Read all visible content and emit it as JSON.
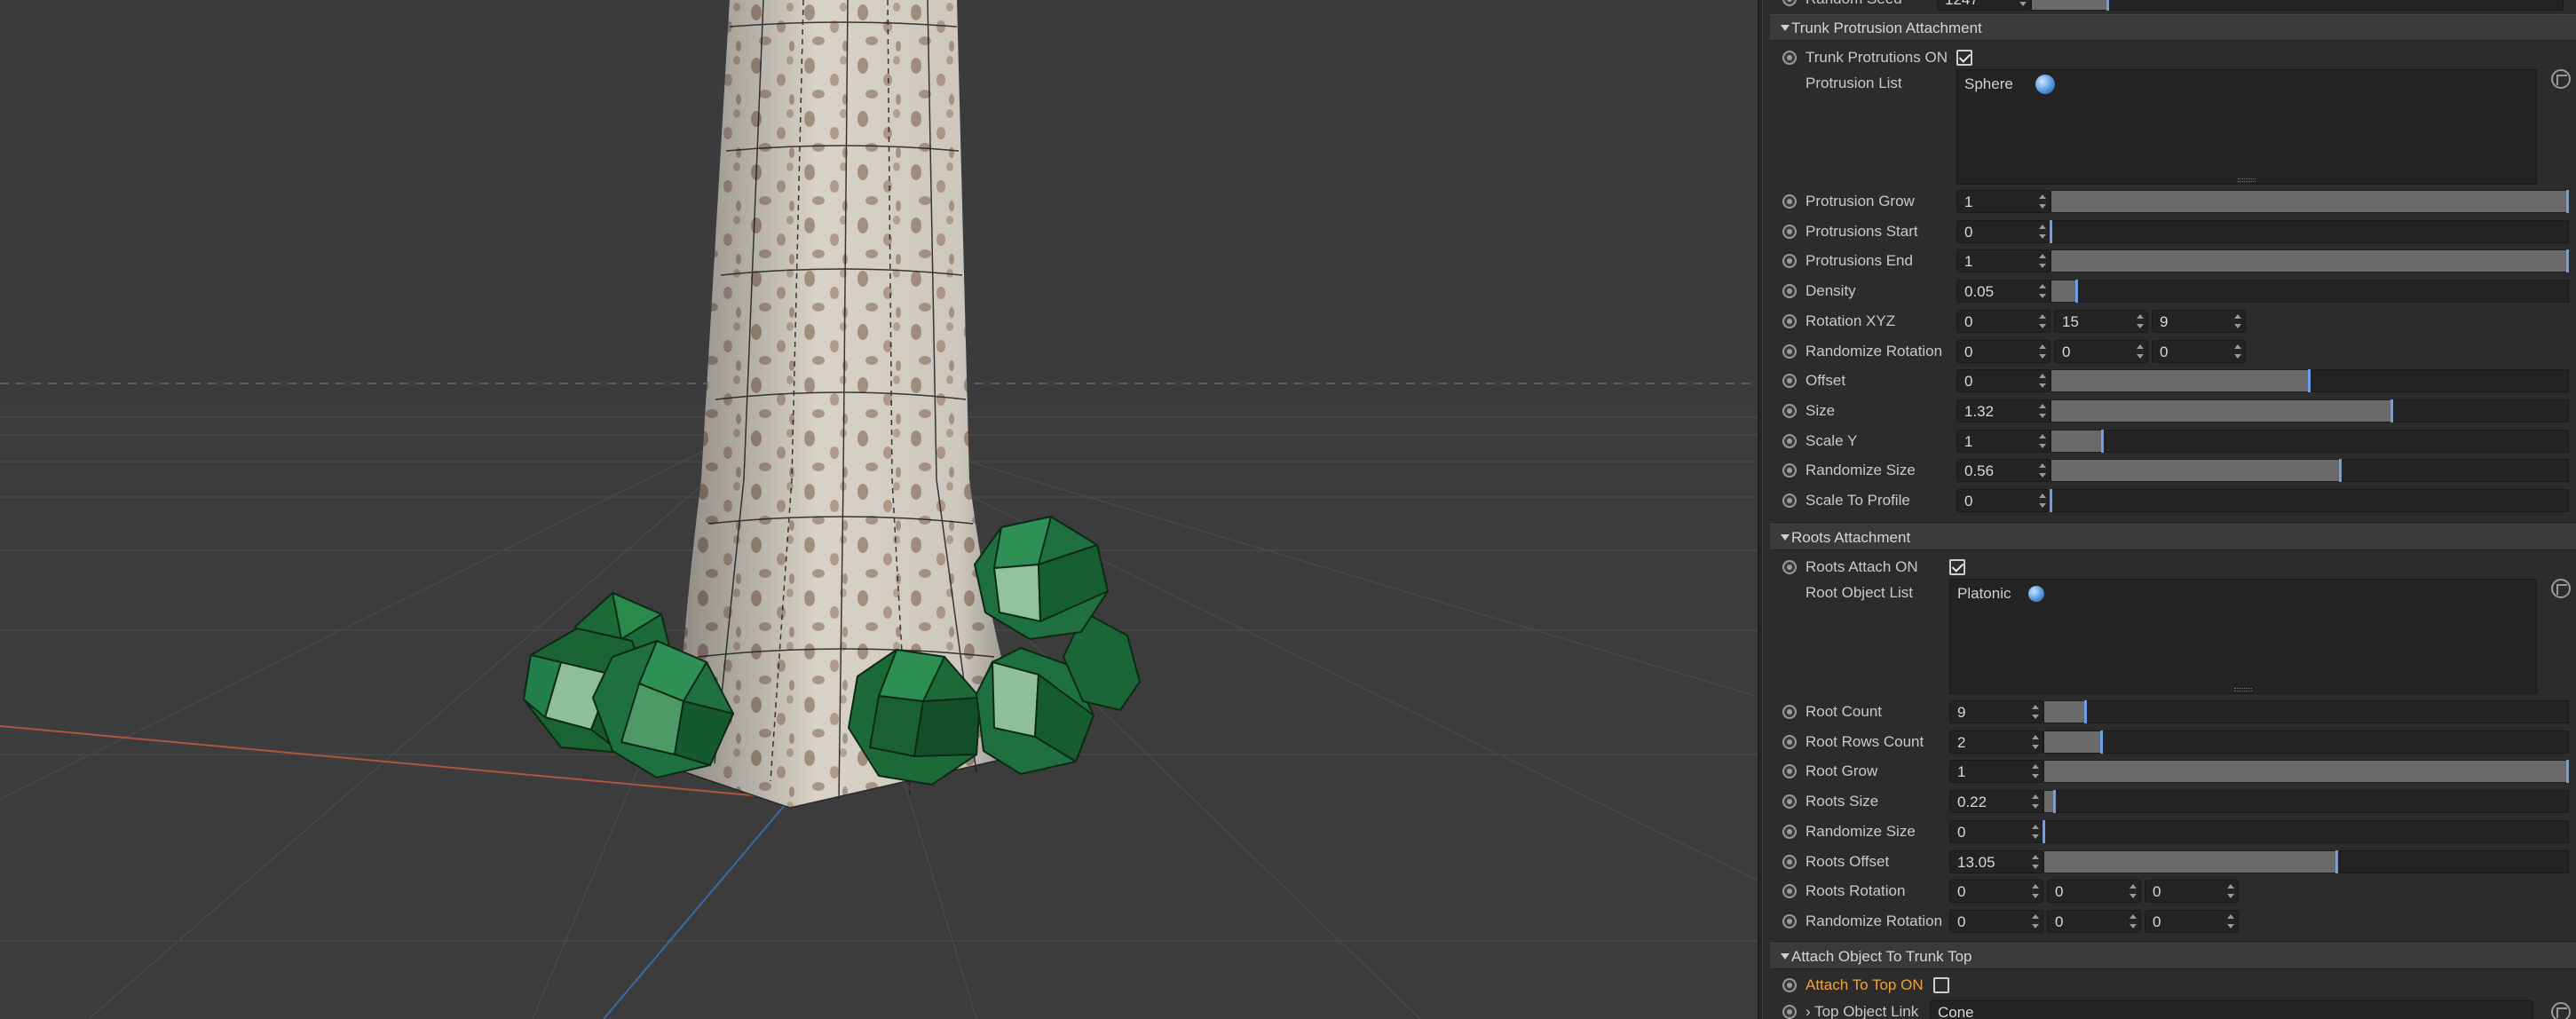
{
  "viewport": {
    "description_name": "3d-viewport"
  },
  "panel": {
    "top_partial": {
      "label": "Random Seed",
      "value": "1247"
    },
    "section_trunk": {
      "title": "Trunk Protrusion Attachment",
      "protrusions_on_label": "Trunk Protrutions ON",
      "protrusions_on_checked": true,
      "protrusion_list_label": "Protrusion List",
      "protrusion_list_item": "Sphere",
      "params": [
        {
          "label": "Protrusion Grow",
          "value": "1",
          "fraction": 1.0
        },
        {
          "label": "Protrusions Start",
          "value": "0",
          "fraction": 0.0
        },
        {
          "label": "Protrusions End",
          "value": "1",
          "fraction": 1.0
        },
        {
          "label": "Density",
          "value": "0.05",
          "fraction": 0.05
        },
        {
          "label": "Offset",
          "value": "0",
          "fraction": 0.5
        },
        {
          "label": "Size",
          "value": "1.32",
          "fraction": 0.66
        },
        {
          "label": "Scale Y",
          "value": "1",
          "fraction": 0.1
        },
        {
          "label": "Randomize Size",
          "value": "0.56",
          "fraction": 0.56
        },
        {
          "label": "Scale To Profile",
          "value": "0",
          "fraction": 0.0
        }
      ],
      "rotation_xyz": {
        "label": "Rotation XYZ",
        "values": [
          "0",
          "15",
          "9"
        ]
      },
      "randomize_rotation": {
        "label": "Randomize Rotation",
        "values": [
          "0",
          "0",
          "0"
        ]
      }
    },
    "section_roots": {
      "title": "Roots Attachment",
      "attach_on_label": "Roots Attach ON",
      "attach_on_checked": true,
      "root_list_label": "Root Object List",
      "root_list_item": "Platonic",
      "params": [
        {
          "label": "Root Count",
          "value": "9",
          "fraction": 0.08
        },
        {
          "label": "Root Rows Count",
          "value": "2",
          "fraction": 0.11
        },
        {
          "label": "Root Grow",
          "value": "1",
          "fraction": 1.0
        },
        {
          "label": "Roots Size",
          "value": "0.22",
          "fraction": 0.02
        },
        {
          "label": "Randomize Size",
          "value": "0",
          "fraction": 0.0
        },
        {
          "label": "Roots Offset",
          "value": "13.05",
          "fraction": 0.56
        }
      ],
      "roots_rotation": {
        "label": "Roots Rotation",
        "values": [
          "0",
          "0",
          "0"
        ]
      },
      "randomize_rotation": {
        "label": "Randomize Rotation",
        "values": [
          "0",
          "0",
          "0"
        ]
      }
    },
    "section_top": {
      "title": "Attach Object To Trunk Top",
      "attach_top_label": "Attach To Top ON",
      "attach_top_checked": false,
      "top_link_label": "Top Object Link",
      "top_link_value": "Cone"
    }
  },
  "colors": {
    "accent_knob": "#6e9fe6",
    "highlight_label": "#f0a23a",
    "protrusion_green": "#1e6e3a"
  }
}
